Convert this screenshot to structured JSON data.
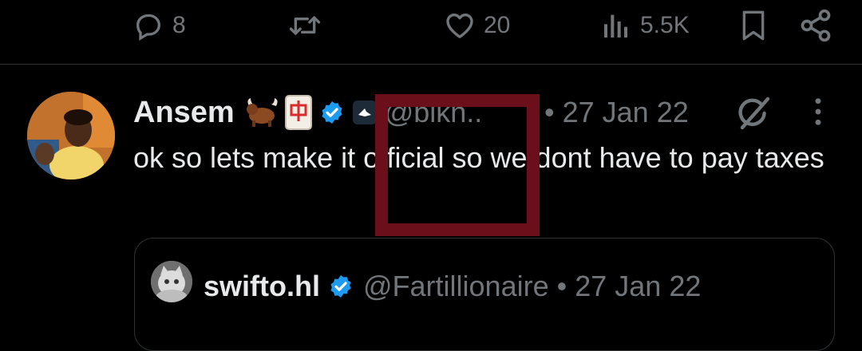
{
  "actions": {
    "replies": "8",
    "retweets": "",
    "likes": "20",
    "views": "5.5K"
  },
  "tweet": {
    "author_name": "Ansem",
    "author_emojis": "🐂🀄",
    "handle": "@blkn..",
    "separator": "•",
    "date": "27 Jan 22",
    "text": "ok so lets make it official so we dont have to pay taxes"
  },
  "quoted": {
    "author_name": "swifto.hl",
    "handle": "@Fartillionaire",
    "separator": "•",
    "date": "27 Jan 22"
  },
  "colors": {
    "background": "#000000",
    "text": "#e7e9ea",
    "muted": "#71767b",
    "verified": "#1d9bf0",
    "overlay": "#6b0f1a"
  }
}
